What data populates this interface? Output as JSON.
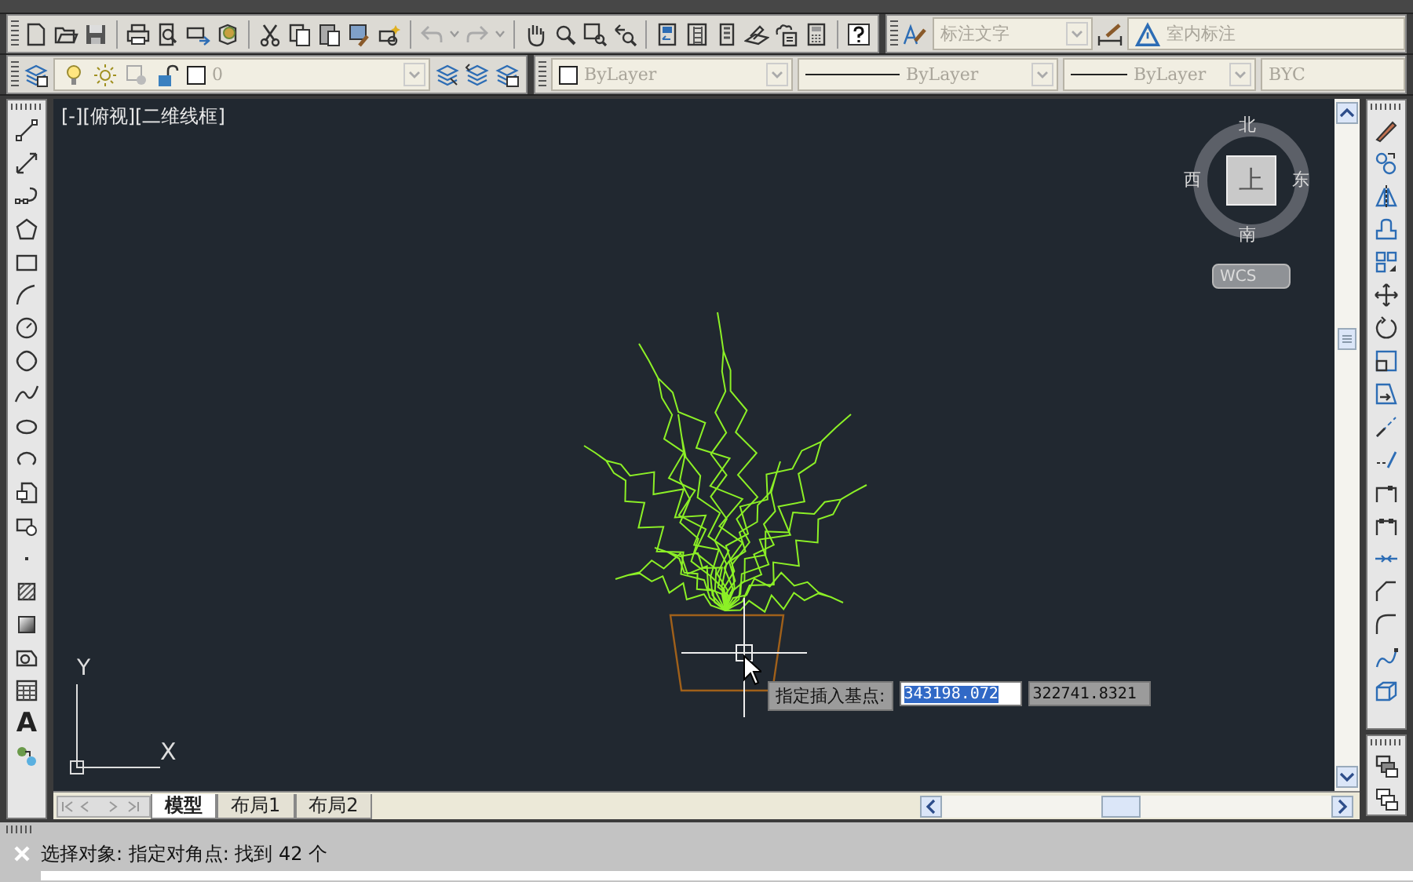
{
  "styles_toolbar": {
    "dimension_style": "标注文字",
    "multileader_style": "室内标注"
  },
  "layers_toolbar": {
    "current_layer": "0"
  },
  "properties_toolbar": {
    "color_setting": "ByLayer",
    "linetype": "ByLayer",
    "lineweight": "ByLayer",
    "plot_style": "BYC"
  },
  "draw_toolbar": {
    "text_tool": "A"
  },
  "viewport_label": "[-][俯视][二维线框]",
  "viewcube": {
    "north": "北",
    "south": "南",
    "east": "东",
    "west": "西",
    "face": "上",
    "coordinate_system": "WCS"
  },
  "ucs_icon": {
    "x_label": "X",
    "y_label": "Y"
  },
  "dynamic_input": {
    "prompt": "指定插入基点:",
    "fields": [
      {
        "value": "343198.072",
        "selected": true
      },
      {
        "value": "322741.8321",
        "selected": false
      }
    ]
  },
  "layout_tabs": [
    {
      "label": "模型",
      "selected": true
    },
    {
      "label": "布局1",
      "selected": false
    },
    {
      "label": "布局2",
      "selected": false
    }
  ],
  "command_line": {
    "text": "选择对象: 指定对角点: 找到 42 个"
  }
}
